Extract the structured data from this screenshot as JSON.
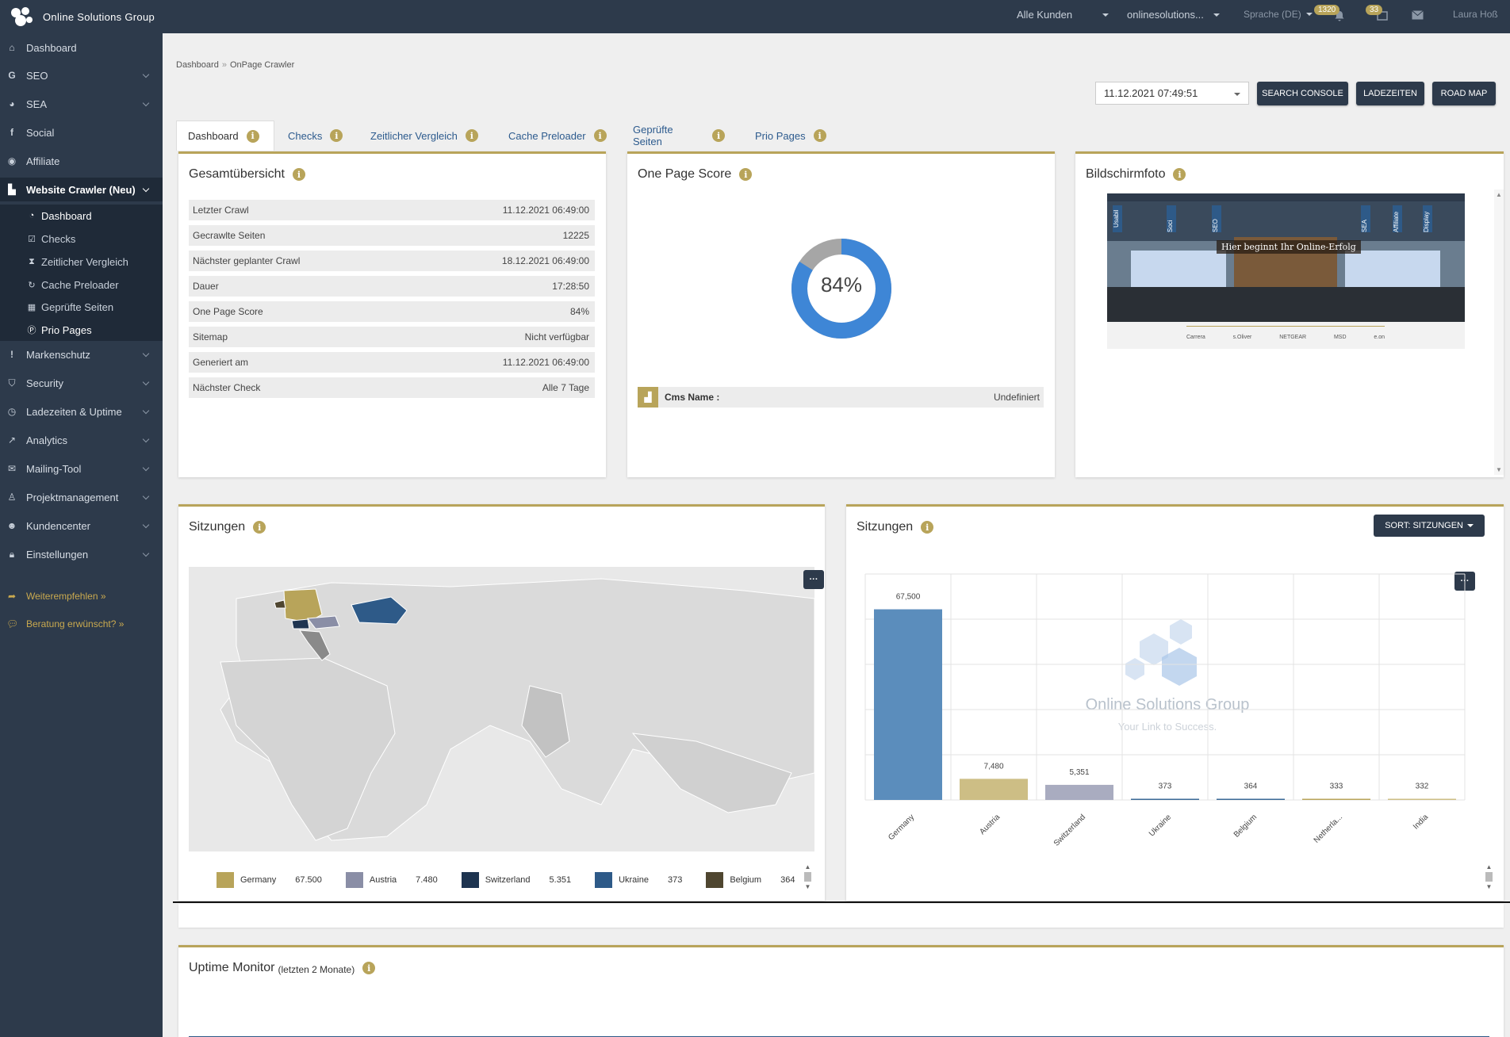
{
  "brand": {
    "name": "Online Solutions Group",
    "accent": "#b8a45a",
    "dark": "#2d3a4b"
  },
  "topbar": {
    "customer_filter": "Alle Kunden",
    "domain_filter": "onlinesolutions...",
    "language": "Sprache (DE)",
    "notifications_count": "1320",
    "messages_count": "33",
    "user_name": "Laura Hoß"
  },
  "sidebar": {
    "items": [
      {
        "label": "Dashboard",
        "icon": "home-icon"
      },
      {
        "label": "SEO",
        "icon": "g-icon"
      },
      {
        "label": "SEA",
        "icon": "pie-icon"
      },
      {
        "label": "Social",
        "icon": "facebook-icon"
      },
      {
        "label": "Affiliate",
        "icon": "eye-icon"
      },
      {
        "label": "Website Crawler (Neu)",
        "icon": "chart-icon"
      },
      {
        "label": "Markenschutz",
        "icon": "exclamation-icon"
      },
      {
        "label": "Security",
        "icon": "shield-icon"
      },
      {
        "label": "Ladezeiten & Uptime",
        "icon": "clock-icon"
      },
      {
        "label": "Analytics",
        "icon": "line-chart-icon"
      },
      {
        "label": "Mailing-Tool",
        "icon": "envelope-icon"
      },
      {
        "label": "Projektmanagement",
        "icon": "sitemap-icon"
      },
      {
        "label": "Kundencenter",
        "icon": "users-icon"
      },
      {
        "label": "Einstellungen",
        "icon": "lock-icon"
      }
    ],
    "subitems": [
      {
        "label": "Dashboard",
        "icon": "dashboard-icon"
      },
      {
        "label": "Checks",
        "icon": "check-square-icon"
      },
      {
        "label": "Zeitlicher Vergleich",
        "icon": "hourglass-icon"
      },
      {
        "label": "Cache Preloader",
        "icon": "refresh-icon"
      },
      {
        "label": "Geprüfte Seiten",
        "icon": "calendar-check-icon"
      },
      {
        "label": "Prio Pages",
        "icon": "p-circle-icon"
      }
    ],
    "recommend": "Weiterempfehlen »",
    "consult": "Beratung erwünscht? »"
  },
  "breadcrumb": {
    "home": "Dashboard",
    "current": "OnPage Crawler"
  },
  "toolbar": {
    "date": "11.12.2021 07:49:51",
    "search_console": "SEARCH CONSOLE",
    "ladezeiten": "LADEZEITEN",
    "road_map": "ROAD MAP"
  },
  "tabs": [
    "Dashboard",
    "Checks",
    "Zeitlicher Vergleich",
    "Cache Preloader",
    "Geprüfte Seiten",
    "Prio Pages"
  ],
  "overview": {
    "title": "Gesamtübersicht",
    "rows": [
      {
        "label": "Letzter Crawl",
        "value": "11.12.2021 06:49:00"
      },
      {
        "label": "Gecrawlte Seiten",
        "value": "12225"
      },
      {
        "label": "Nächster geplanter Crawl",
        "value": "18.12.2021 06:49:00"
      },
      {
        "label": "Dauer",
        "value": "17:28:50"
      },
      {
        "label": "One Page Score",
        "value": "84%"
      },
      {
        "label": "Sitemap",
        "value": "Nicht verfügbar"
      },
      {
        "label": "Generiert am",
        "value": "11.12.2021 06:49:00"
      },
      {
        "label": "Nächster Check",
        "value": "Alle 7 Tage"
      }
    ]
  },
  "score": {
    "title": "One Page Score",
    "value": 84,
    "label": "84%",
    "cms_label": "Cms Name :",
    "cms_value": "Undefiniert"
  },
  "screenshot": {
    "title": "Bildschirmfoto",
    "headline": "Hier beginnt Ihr Online-Erfolg",
    "nav_tags": [
      "Usabil",
      "Soci",
      "SEO",
      "SEA",
      "Affiliate",
      "Display"
    ],
    "logos": [
      "Carrera",
      "s.Oliver",
      "NETGEAR",
      "MSD",
      "e.on"
    ]
  },
  "map_panel": {
    "title": "Sitzungen",
    "legend": [
      {
        "name": "Germany",
        "value": "67.500",
        "color": "#b8a45a"
      },
      {
        "name": "Austria",
        "value": "7.480",
        "color": "#8a8ea6"
      },
      {
        "name": "Switzerland",
        "value": "5.351",
        "color": "#1e3450"
      },
      {
        "name": "Ukraine",
        "value": "373",
        "color": "#2e5a88"
      },
      {
        "name": "Belgium",
        "value": "364",
        "color": "#4f4630"
      }
    ]
  },
  "bar_panel": {
    "title": "Sitzungen",
    "sort_label": "SORT: SITZUNGEN",
    "watermark_name": "Online Solutions Group",
    "watermark_tagline": "Your Link to Success."
  },
  "chart_data": {
    "type": "bar",
    "categories": [
      "Germany",
      "Austria",
      "Switzerland",
      "Ukraine",
      "Belgium",
      "Netherla...",
      "India"
    ],
    "values": [
      67500,
      7480,
      5351,
      373,
      364,
      333,
      332
    ],
    "value_labels": [
      "67,500",
      "7,480",
      "5,351",
      "373",
      "364",
      "333",
      "332"
    ],
    "colors": [
      "#5b8dbc",
      "#cdbe85",
      "#a9acc0",
      "#3b6a97",
      "#3b6a97",
      "#b8a45a",
      "#cdbe85"
    ],
    "ylim": [
      0,
      80000
    ],
    "grid": true
  },
  "uptime": {
    "title": "Uptime Monitor",
    "subtitle": "(letzten 2 Monate)"
  }
}
